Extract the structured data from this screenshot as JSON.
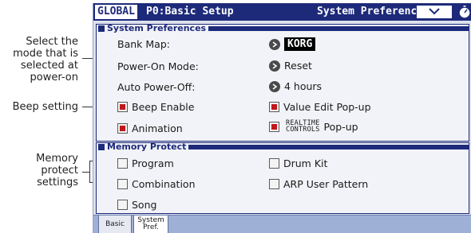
{
  "callouts": {
    "mode_l1": "Select the",
    "mode_l2": "mode that is",
    "mode_l3": "selected at",
    "mode_l4": "power-on",
    "beep": "Beep setting",
    "mem_l1": "Memory",
    "mem_l2": "protect",
    "mem_l3": "settings"
  },
  "header": {
    "mode": "GLOBAL",
    "page": "P0:Basic Setup",
    "section": "System Preferences",
    "menu_icon": "chevron-down-icon",
    "clock_icon": "stopwatch-icon"
  },
  "system_preferences": {
    "title": "System Preferences",
    "bank_map_label": "Bank Map:",
    "bank_map_value": "KORG",
    "power_on_mode_label": "Power-On Mode:",
    "power_on_mode_value": "Reset",
    "auto_power_off_label": "Auto Power-Off:",
    "auto_power_off_value": "4 hours",
    "beep_enable_label": "Beep Enable",
    "beep_enable_checked": true,
    "value_edit_popup_label": "Value Edit Pop-up",
    "value_edit_popup_checked": true,
    "animation_label": "Animation",
    "animation_checked": true,
    "realtime_l1": "REALTIME",
    "realtime_l2": "CONTROLS",
    "realtime_popup_label": "Pop-up",
    "realtime_popup_checked": true
  },
  "memory_protect": {
    "title": "Memory Protect",
    "program_label": "Program",
    "program_checked": false,
    "combination_label": "Combination",
    "combination_checked": false,
    "song_label": "Song",
    "song_checked": false,
    "drum_kit_label": "Drum Kit",
    "drum_kit_checked": false,
    "arp_user_pattern_label": "ARP User Pattern",
    "arp_user_pattern_checked": false
  },
  "tabs": {
    "basic": "Basic",
    "sys_l1": "System",
    "sys_l2": "Pref.",
    "active": "System Pref."
  },
  "colors": {
    "title_bar": "#1d2a7a",
    "checkbox_on": "#c0171a",
    "panel_bg": "#dde1ec",
    "tab_strip": "#9fb0d6"
  }
}
